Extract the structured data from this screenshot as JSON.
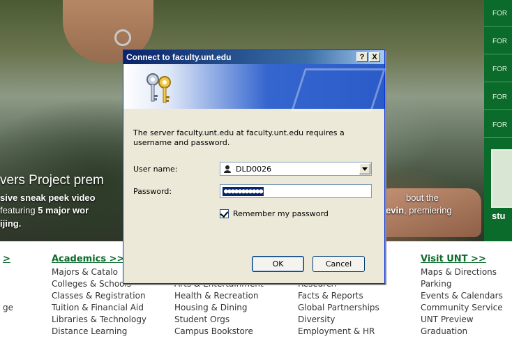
{
  "hero": {
    "caption_title": "vers Project prem",
    "caption_line1_bold": "sive sneak peek video",
    "caption_line1_right": "bout the",
    "caption_line2_prefix": "featuring ",
    "caption_line2_bold": "5 major wor",
    "caption_line2_right_bold": "evin",
    "caption_line2_right": ", premiering",
    "caption_line3": "ijing."
  },
  "side_nav": {
    "items": [
      "FOR",
      "FOR",
      "FOR",
      "FOR",
      "FOR"
    ],
    "promo_text": "stu"
  },
  "columns": {
    "col0": {
      "head": ">",
      "links": [
        "",
        "",
        "",
        "ge",
        ""
      ]
    },
    "academics": {
      "head": "Academics >>",
      "links": [
        "Majors & Catalo",
        "Colleges & Schools",
        "Classes & Registration",
        "Tuition & Financial Aid",
        "Libraries & Technology",
        "Distance Learning"
      ]
    },
    "col2": {
      "links": [
        "Arts & Entertainment",
        "Health & Recreation",
        "Housing & Dining",
        "Student Orgs",
        "Campus Bookstore"
      ]
    },
    "col3": {
      "links": [
        "Research",
        "Facts & Reports",
        "Global Partnerships",
        "Diversity",
        "Employment & HR"
      ]
    },
    "visit": {
      "head": "Visit UNT >>",
      "links": [
        "Maps & Directions",
        "Parking",
        "Events & Calendars",
        "Community Service",
        "UNT Preview",
        "Graduation"
      ]
    }
  },
  "dialog": {
    "title": "Connect to faculty.unt.edu",
    "help_btn": "?",
    "close_btn": "X",
    "message": "The server faculty.unt.edu at faculty.unt.edu requires a username and password.",
    "username_label": "User name:",
    "username_value": "DLD0026",
    "password_label": "Password:",
    "password_value": "●●●●●●●●●●●",
    "remember_label": "Remember my password",
    "remember_checked": true,
    "ok_label": "OK",
    "cancel_label": "Cancel"
  }
}
